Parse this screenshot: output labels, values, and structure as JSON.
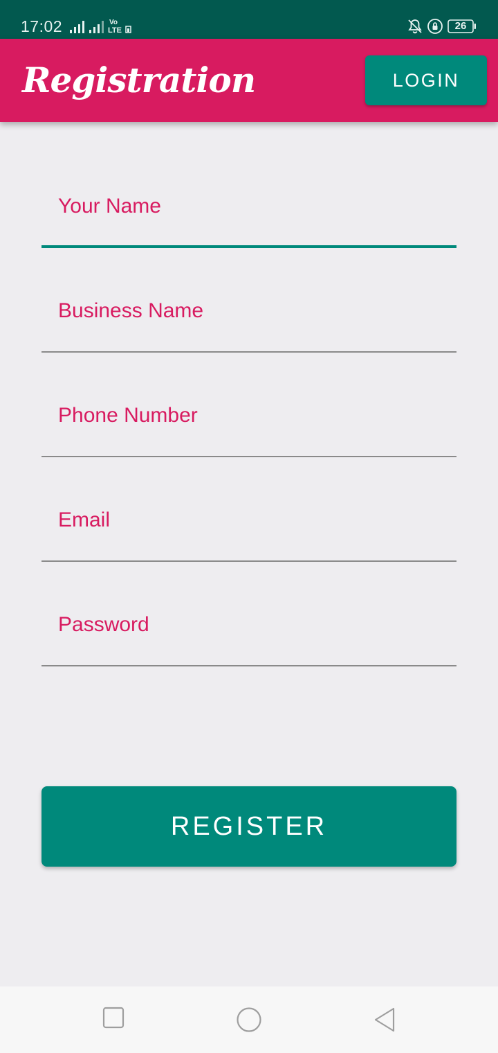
{
  "status_bar": {
    "time": "17:02",
    "battery_level": "26",
    "icons": [
      "signal-icon",
      "signal-icon",
      "volte-icon",
      "notifications-muted-icon",
      "rotation-lock-icon",
      "battery-icon"
    ]
  },
  "app_bar": {
    "title": "Registration",
    "login_label": "LOGIN"
  },
  "form": {
    "fields": [
      {
        "label": "Your Name",
        "focused": true
      },
      {
        "label": "Business Name",
        "focused": false
      },
      {
        "label": "Phone Number",
        "focused": false
      },
      {
        "label": "Email",
        "focused": false
      },
      {
        "label": "Password",
        "focused": false
      }
    ],
    "register_label": "REGISTER"
  },
  "nav_bar": {
    "icons": [
      "recent-apps-icon",
      "home-icon",
      "back-icon"
    ]
  },
  "colors": {
    "status_bar": "#02594f",
    "app_bar": "#d81b60",
    "accent": "#00897b",
    "label": "#d81b60",
    "background": "#eeedf0"
  }
}
